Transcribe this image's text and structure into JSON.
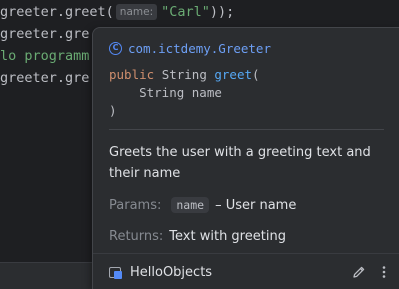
{
  "editor": {
    "lines": [
      {
        "prefix": "greeter.greet(",
        "hint": "name:",
        "string": "\"Carl\"",
        "suffix": "));"
      },
      {
        "text": "greeter.gre"
      },
      {
        "text": "lo programm"
      },
      {
        "text": "greeter.gre"
      }
    ]
  },
  "popup": {
    "class_icon": "C",
    "class_name": "com.ictdemy.Greeter",
    "signature": {
      "keyword": "public",
      "return_type": "String",
      "method": "greet",
      "open_paren": "(",
      "param_line": "    String name",
      "close_paren": ")"
    },
    "description": "Greets the user with a greeting text and their name",
    "params_label": "Params:",
    "param_name": "name",
    "param_desc": "– User name",
    "returns_label": "Returns:",
    "returns_text": "Text with greeting",
    "module_name": "HelloObjects",
    "edit_icon": "pencil-icon",
    "more_icon": "more-vertical-icon"
  },
  "colors": {
    "editor_bg": "#1e1f22",
    "popup_bg": "#2b2d30",
    "link": "#6d9ff5",
    "keyword": "#cf8e6d",
    "method": "#56a8f5",
    "string": "#6aab73"
  }
}
